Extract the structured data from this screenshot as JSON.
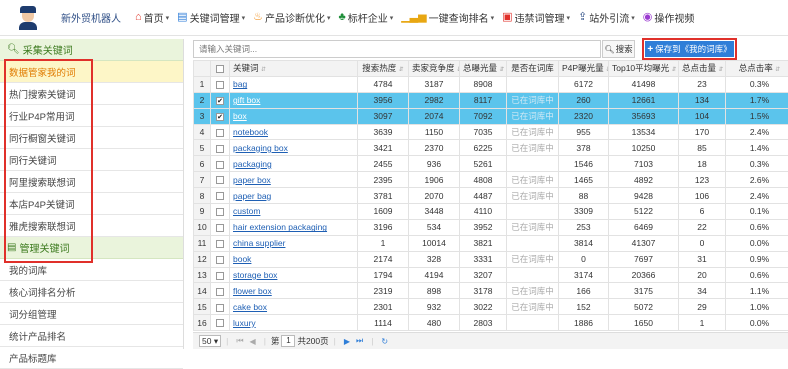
{
  "brand": "新外贸机器人",
  "nav": [
    {
      "icon": "⌂",
      "icon_name": "home-icon",
      "color": "#e03a2e",
      "label": "首页",
      "caret": true
    },
    {
      "icon": "▤",
      "icon_name": "keyword-manage-icon",
      "color": "#2f7ed8",
      "label": "关键词管理",
      "caret": true
    },
    {
      "icon": "♨",
      "icon_name": "diagnosis-icon",
      "color": "#f08a12",
      "label": "产品诊断优化",
      "caret": true
    },
    {
      "icon": "♣",
      "icon_name": "benchmark-icon",
      "color": "#1f8f3a",
      "label": "标杆企业",
      "caret": true
    },
    {
      "icon": "▁▃▅",
      "icon_name": "rank-query-icon",
      "color": "#e8a712",
      "label": "一键查询排名",
      "caret": true
    },
    {
      "icon": "▣",
      "icon_name": "banned-words-icon",
      "color": "#e0302a",
      "label": "违禁词管理",
      "caret": true
    },
    {
      "icon": "⇪",
      "icon_name": "traffic-icon",
      "color": "#2e4e86",
      "label": "站外引流",
      "caret": true
    },
    {
      "icon": "◉",
      "icon_name": "video-icon",
      "color": "#9b3bd0",
      "label": "操作视频",
      "caret": false
    }
  ],
  "sidebar": {
    "collect_header": "采集关键词",
    "collect_items": [
      "数据管家我的词",
      "热门搜索关键词",
      "行业P4P常用词",
      "同行橱窗关键词",
      "同行关键词",
      "阿里搜索联想词",
      "本店P4P关键词",
      "雅虎搜索联想词"
    ],
    "manage_header": "管理关键词",
    "manage_items": [
      "我的词库",
      "核心词排名分析",
      "词分组管理",
      "统计产品排名",
      "产品标题库"
    ]
  },
  "search": {
    "placeholder": "请输入关键词...",
    "button_label": "搜索"
  },
  "save_button": "保存到《我的词库》",
  "table": {
    "headers": [
      "关键词",
      "搜索热度",
      "卖家竞争度",
      "总曝光量",
      "是否在词库",
      "P4P曝光量",
      "Top10平均曝光",
      "总点击量",
      "总点击率"
    ],
    "rows": [
      {
        "n": "1",
        "checked": false,
        "sel": false,
        "kw": "bag",
        "heat": "4784",
        "comp": "3187",
        "exp": "8908",
        "inlib": "",
        "p4p": "6172",
        "top10": "41498",
        "clicks": "23",
        "ctr": "0.3%"
      },
      {
        "n": "2",
        "checked": true,
        "sel": true,
        "kw": "gift box",
        "heat": "3956",
        "comp": "2982",
        "exp": "8117",
        "inlib": "已在词库中",
        "p4p": "260",
        "top10": "12661",
        "clicks": "134",
        "ctr": "1.7%"
      },
      {
        "n": "3",
        "checked": true,
        "sel": true,
        "kw": "box",
        "heat": "3097",
        "comp": "2074",
        "exp": "7092",
        "inlib": "已在词库中",
        "p4p": "2320",
        "top10": "35693",
        "clicks": "104",
        "ctr": "1.5%"
      },
      {
        "n": "4",
        "checked": false,
        "sel": false,
        "kw": "notebook",
        "heat": "3639",
        "comp": "1150",
        "exp": "7035",
        "inlib": "已在词库中",
        "p4p": "955",
        "top10": "13534",
        "clicks": "170",
        "ctr": "2.4%"
      },
      {
        "n": "5",
        "checked": false,
        "sel": false,
        "kw": "packaging box",
        "heat": "3421",
        "comp": "2370",
        "exp": "6225",
        "inlib": "已在词库中",
        "p4p": "378",
        "top10": "10250",
        "clicks": "85",
        "ctr": "1.4%"
      },
      {
        "n": "6",
        "checked": false,
        "sel": false,
        "kw": "packaging",
        "heat": "2455",
        "comp": "936",
        "exp": "5261",
        "inlib": "",
        "p4p": "1546",
        "top10": "7103",
        "clicks": "18",
        "ctr": "0.3%"
      },
      {
        "n": "7",
        "checked": false,
        "sel": false,
        "kw": "paper box",
        "heat": "2395",
        "comp": "1906",
        "exp": "4808",
        "inlib": "已在词库中",
        "p4p": "1465",
        "top10": "4892",
        "clicks": "123",
        "ctr": "2.6%"
      },
      {
        "n": "8",
        "checked": false,
        "sel": false,
        "kw": "paper bag",
        "heat": "3781",
        "comp": "2070",
        "exp": "4487",
        "inlib": "已在词库中",
        "p4p": "88",
        "top10": "9428",
        "clicks": "106",
        "ctr": "2.4%"
      },
      {
        "n": "9",
        "checked": false,
        "sel": false,
        "kw": "custom",
        "heat": "1609",
        "comp": "3448",
        "exp": "4110",
        "inlib": "",
        "p4p": "3309",
        "top10": "5122",
        "clicks": "6",
        "ctr": "0.1%"
      },
      {
        "n": "10",
        "checked": false,
        "sel": false,
        "kw": "hair extension packaging",
        "heat": "3196",
        "comp": "534",
        "exp": "3952",
        "inlib": "已在词库中",
        "p4p": "253",
        "top10": "6469",
        "clicks": "22",
        "ctr": "0.6%"
      },
      {
        "n": "11",
        "checked": false,
        "sel": false,
        "kw": "china supplier",
        "heat": "1",
        "comp": "10014",
        "exp": "3821",
        "inlib": "",
        "p4p": "3814",
        "top10": "41307",
        "clicks": "0",
        "ctr": "0.0%"
      },
      {
        "n": "12",
        "checked": false,
        "sel": false,
        "kw": "book",
        "heat": "2174",
        "comp": "328",
        "exp": "3331",
        "inlib": "已在词库中",
        "p4p": "0",
        "top10": "7697",
        "clicks": "31",
        "ctr": "0.9%"
      },
      {
        "n": "13",
        "checked": false,
        "sel": false,
        "kw": "storage box",
        "heat": "1794",
        "comp": "4194",
        "exp": "3207",
        "inlib": "",
        "p4p": "3174",
        "top10": "20366",
        "clicks": "20",
        "ctr": "0.6%"
      },
      {
        "n": "14",
        "checked": false,
        "sel": false,
        "kw": "flower box",
        "heat": "2319",
        "comp": "898",
        "exp": "3178",
        "inlib": "已在词库中",
        "p4p": "166",
        "top10": "3175",
        "clicks": "34",
        "ctr": "1.1%"
      },
      {
        "n": "15",
        "checked": false,
        "sel": false,
        "kw": "cake box",
        "heat": "2301",
        "comp": "932",
        "exp": "3022",
        "inlib": "已在词库中",
        "p4p": "152",
        "top10": "5072",
        "clicks": "29",
        "ctr": "1.0%"
      },
      {
        "n": "16",
        "checked": false,
        "sel": false,
        "kw": "luxury",
        "heat": "1114",
        "comp": "480",
        "exp": "2803",
        "inlib": "",
        "p4p": "1886",
        "top10": "1650",
        "clicks": "1",
        "ctr": "0.0%"
      }
    ]
  },
  "pager": {
    "page_size": "50",
    "page_prefix": "第",
    "current_page": "1",
    "total_pages": "共200页"
  }
}
